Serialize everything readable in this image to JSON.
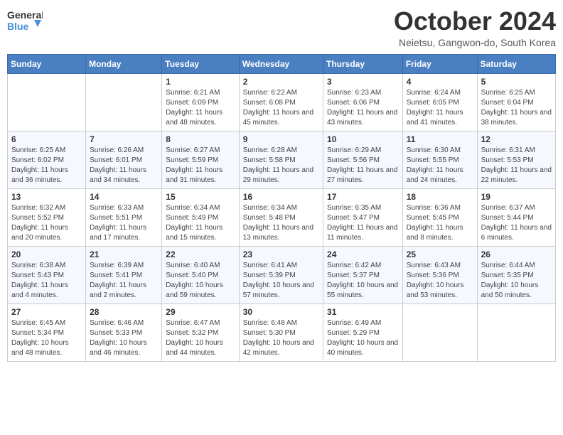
{
  "header": {
    "logo_general": "General",
    "logo_blue": "Blue",
    "month_title": "October 2024",
    "location": "Neietsu, Gangwon-do, South Korea"
  },
  "days_of_week": [
    "Sunday",
    "Monday",
    "Tuesday",
    "Wednesday",
    "Thursday",
    "Friday",
    "Saturday"
  ],
  "weeks": [
    [
      {
        "day": "",
        "info": ""
      },
      {
        "day": "",
        "info": ""
      },
      {
        "day": "1",
        "info": "Sunrise: 6:21 AM\nSunset: 6:09 PM\nDaylight: 11 hours and 48 minutes."
      },
      {
        "day": "2",
        "info": "Sunrise: 6:22 AM\nSunset: 6:08 PM\nDaylight: 11 hours and 45 minutes."
      },
      {
        "day": "3",
        "info": "Sunrise: 6:23 AM\nSunset: 6:06 PM\nDaylight: 11 hours and 43 minutes."
      },
      {
        "day": "4",
        "info": "Sunrise: 6:24 AM\nSunset: 6:05 PM\nDaylight: 11 hours and 41 minutes."
      },
      {
        "day": "5",
        "info": "Sunrise: 6:25 AM\nSunset: 6:04 PM\nDaylight: 11 hours and 38 minutes."
      }
    ],
    [
      {
        "day": "6",
        "info": "Sunrise: 6:25 AM\nSunset: 6:02 PM\nDaylight: 11 hours and 36 minutes."
      },
      {
        "day": "7",
        "info": "Sunrise: 6:26 AM\nSunset: 6:01 PM\nDaylight: 11 hours and 34 minutes."
      },
      {
        "day": "8",
        "info": "Sunrise: 6:27 AM\nSunset: 5:59 PM\nDaylight: 11 hours and 31 minutes."
      },
      {
        "day": "9",
        "info": "Sunrise: 6:28 AM\nSunset: 5:58 PM\nDaylight: 11 hours and 29 minutes."
      },
      {
        "day": "10",
        "info": "Sunrise: 6:29 AM\nSunset: 5:56 PM\nDaylight: 11 hours and 27 minutes."
      },
      {
        "day": "11",
        "info": "Sunrise: 6:30 AM\nSunset: 5:55 PM\nDaylight: 11 hours and 24 minutes."
      },
      {
        "day": "12",
        "info": "Sunrise: 6:31 AM\nSunset: 5:53 PM\nDaylight: 11 hours and 22 minutes."
      }
    ],
    [
      {
        "day": "13",
        "info": "Sunrise: 6:32 AM\nSunset: 5:52 PM\nDaylight: 11 hours and 20 minutes."
      },
      {
        "day": "14",
        "info": "Sunrise: 6:33 AM\nSunset: 5:51 PM\nDaylight: 11 hours and 17 minutes."
      },
      {
        "day": "15",
        "info": "Sunrise: 6:34 AM\nSunset: 5:49 PM\nDaylight: 11 hours and 15 minutes."
      },
      {
        "day": "16",
        "info": "Sunrise: 6:34 AM\nSunset: 5:48 PM\nDaylight: 11 hours and 13 minutes."
      },
      {
        "day": "17",
        "info": "Sunrise: 6:35 AM\nSunset: 5:47 PM\nDaylight: 11 hours and 11 minutes."
      },
      {
        "day": "18",
        "info": "Sunrise: 6:36 AM\nSunset: 5:45 PM\nDaylight: 11 hours and 8 minutes."
      },
      {
        "day": "19",
        "info": "Sunrise: 6:37 AM\nSunset: 5:44 PM\nDaylight: 11 hours and 6 minutes."
      }
    ],
    [
      {
        "day": "20",
        "info": "Sunrise: 6:38 AM\nSunset: 5:43 PM\nDaylight: 11 hours and 4 minutes."
      },
      {
        "day": "21",
        "info": "Sunrise: 6:39 AM\nSunset: 5:41 PM\nDaylight: 11 hours and 2 minutes."
      },
      {
        "day": "22",
        "info": "Sunrise: 6:40 AM\nSunset: 5:40 PM\nDaylight: 10 hours and 59 minutes."
      },
      {
        "day": "23",
        "info": "Sunrise: 6:41 AM\nSunset: 5:39 PM\nDaylight: 10 hours and 57 minutes."
      },
      {
        "day": "24",
        "info": "Sunrise: 6:42 AM\nSunset: 5:37 PM\nDaylight: 10 hours and 55 minutes."
      },
      {
        "day": "25",
        "info": "Sunrise: 6:43 AM\nSunset: 5:36 PM\nDaylight: 10 hours and 53 minutes."
      },
      {
        "day": "26",
        "info": "Sunrise: 6:44 AM\nSunset: 5:35 PM\nDaylight: 10 hours and 50 minutes."
      }
    ],
    [
      {
        "day": "27",
        "info": "Sunrise: 6:45 AM\nSunset: 5:34 PM\nDaylight: 10 hours and 48 minutes."
      },
      {
        "day": "28",
        "info": "Sunrise: 6:46 AM\nSunset: 5:33 PM\nDaylight: 10 hours and 46 minutes."
      },
      {
        "day": "29",
        "info": "Sunrise: 6:47 AM\nSunset: 5:32 PM\nDaylight: 10 hours and 44 minutes."
      },
      {
        "day": "30",
        "info": "Sunrise: 6:48 AM\nSunset: 5:30 PM\nDaylight: 10 hours and 42 minutes."
      },
      {
        "day": "31",
        "info": "Sunrise: 6:49 AM\nSunset: 5:29 PM\nDaylight: 10 hours and 40 minutes."
      },
      {
        "day": "",
        "info": ""
      },
      {
        "day": "",
        "info": ""
      }
    ]
  ]
}
